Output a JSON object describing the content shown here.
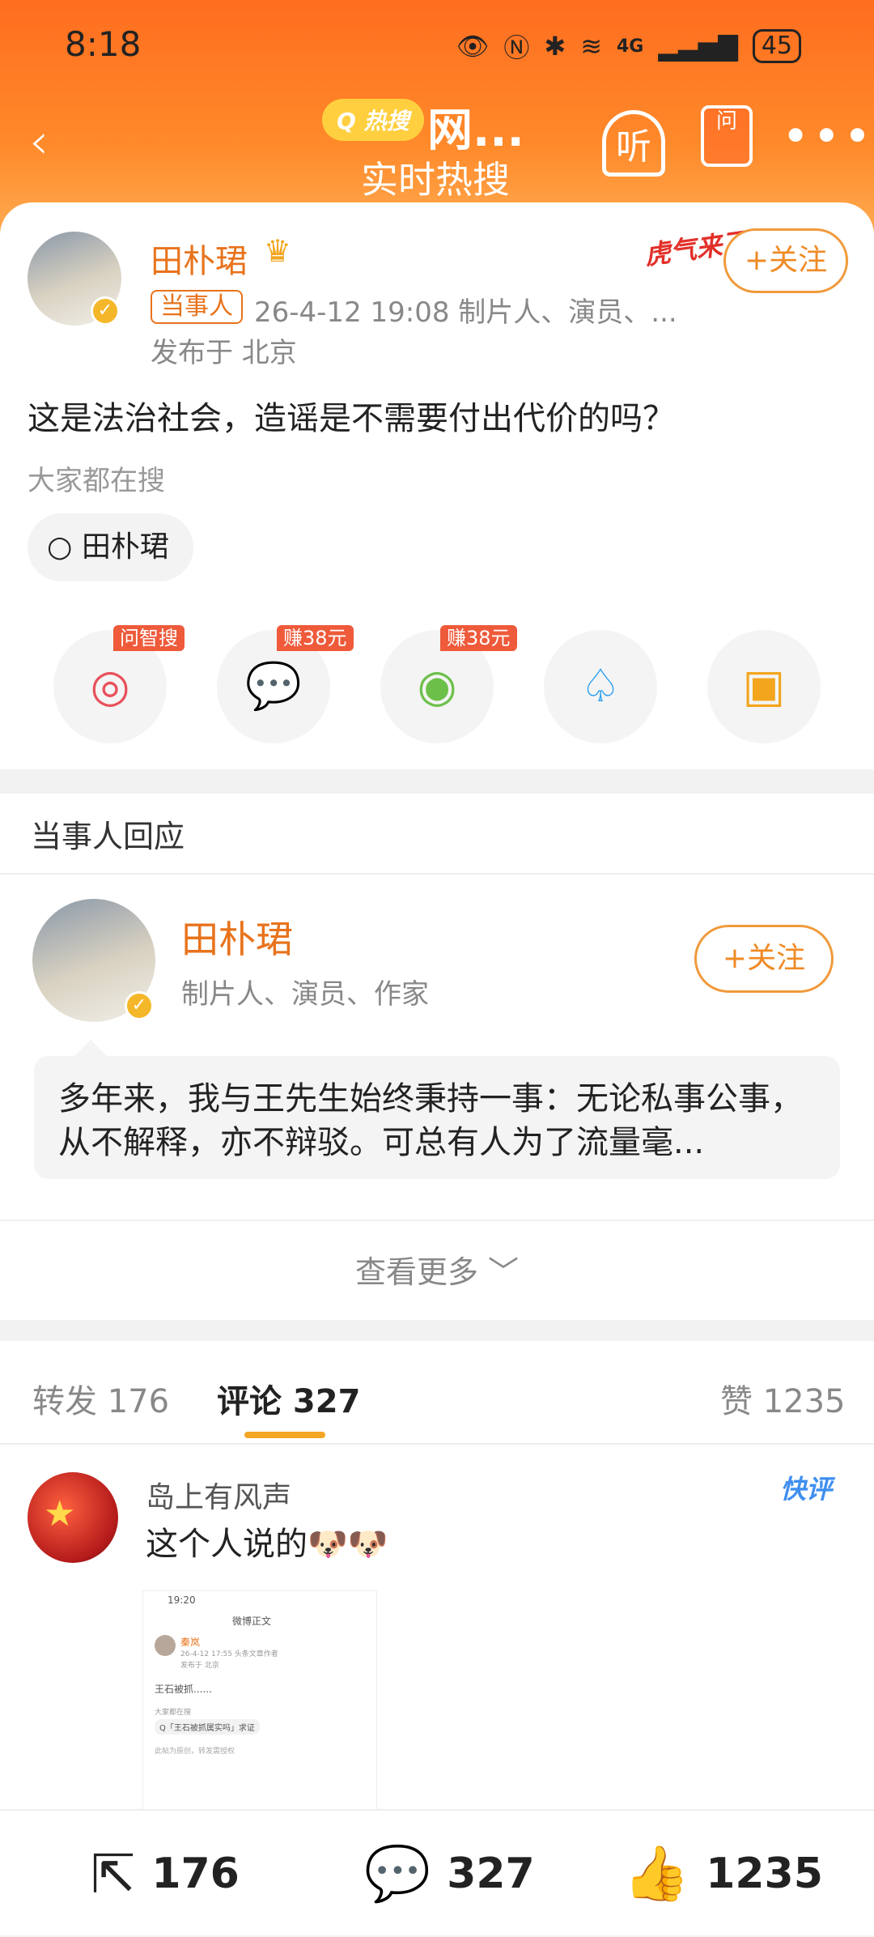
{
  "status_bar": {
    "time": "8:18",
    "signal": "4G",
    "battery": "45"
  },
  "nav": {
    "back": "‹",
    "hot_badge": "热搜",
    "title": "网...",
    "subtitle": "实时热搜",
    "listen_label": "听",
    "ask_label": "问",
    "more": "•••"
  },
  "post": {
    "author": "田朴珺",
    "role_tag": "当事人",
    "meta": "26-4-12 19:08  制片人、演员、...",
    "location": "发布于 北京",
    "text": "这是法治社会，造谣是不需要付出代价的吗？",
    "search_hint": "大家都在搜",
    "search_chip": "田朴珺",
    "follow": "+关注",
    "tiger_badge": "虎气来了"
  },
  "share_tags": [
    "问智搜",
    "赚38元",
    "赚38元"
  ],
  "response": {
    "section_title": "当事人回应",
    "name": "田朴珺",
    "role": "制片人、演员、作家",
    "follow": "+关注",
    "quote": "多年来，我与王先生始终秉持一事：无论私事公事，从不解释，亦不辩驳。可总有人为了流量毫...",
    "more": "查看更多 ﹀"
  },
  "tabs": [
    {
      "label": "转发 176"
    },
    {
      "label": "评论 327"
    },
    {
      "label": "赞 1235"
    }
  ],
  "comment": {
    "user": "岛上有风声",
    "text": "这个人说的🐶🐶",
    "badge": "快评",
    "thumb": {
      "time": "19:20",
      "title": "微博正文",
      "name": "秦岚",
      "meta": "26-4-12 17:55 头条文章作者",
      "loc": "发布于 北京",
      "text": "王石被抓......",
      "search_hint": "大家都在搜",
      "chip": "Q「王石被抓属实吗」求证",
      "footer": "此帖为原创，转发需授权"
    }
  },
  "bottom_bar": {
    "reposts": "176",
    "comments": "327",
    "likes": "1235"
  }
}
